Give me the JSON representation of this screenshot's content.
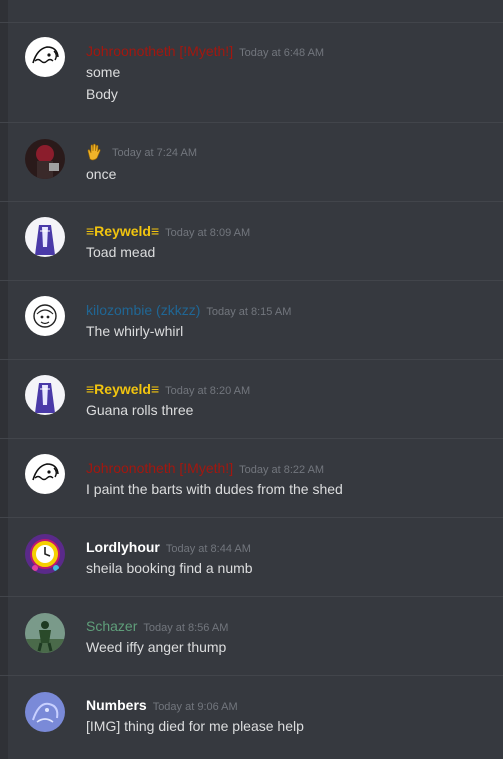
{
  "colors": {
    "background": "#36393f",
    "divider": "#42454b",
    "text": "#dcddde",
    "timestamp": "#72767d",
    "johroonotheth": "#a3170f",
    "reyweld": "#f1c40f",
    "kilozombie": "#206694",
    "lordlyhour": "#ffffff",
    "schazer": "#5f9e7a",
    "numbers": "#ffffff"
  },
  "messages": [
    {
      "author": "Johroonotheth [!Myeth!]",
      "timestamp": "Today at 6:48 AM",
      "lines": [
        "some",
        "Body"
      ],
      "avatar_icon": "sketch-face-avatar"
    },
    {
      "author_icon": "raised-hand-emoji-icon",
      "timestamp": "Today at 7:24 AM",
      "lines": [
        "once"
      ],
      "avatar_icon": "dark-red-figure-avatar"
    },
    {
      "author": "≡Reyweld≡",
      "timestamp": "Today at 8:09 AM",
      "lines": [
        "Toad mead"
      ],
      "avatar_icon": "purple-robe-figure-avatar"
    },
    {
      "author": "kilozombie (zkkzz)",
      "timestamp": "Today at 8:15 AM",
      "lines": [
        "The whirly-whirl"
      ],
      "avatar_icon": "sketch-creature-avatar"
    },
    {
      "author": "≡Reyweld≡",
      "timestamp": "Today at 8:20 AM",
      "lines": [
        "Guana rolls three"
      ],
      "avatar_icon": "purple-robe-figure-avatar"
    },
    {
      "author": "Johroonotheth [!Myeth!]",
      "timestamp": "Today at 8:22 AM",
      "lines": [
        "I paint the barts with dudes from the shed"
      ],
      "avatar_icon": "sketch-face-avatar"
    },
    {
      "author": "Lordlyhour",
      "timestamp": "Today at 8:44 AM",
      "lines": [
        "sheila booking find a numb"
      ],
      "avatar_icon": "clock-avatar"
    },
    {
      "author": "Schazer",
      "timestamp": "Today at 8:56 AM",
      "lines": [
        "Weed iffy anger thump"
      ],
      "avatar_icon": "green-figure-avatar"
    },
    {
      "author": "Numbers",
      "timestamp": "Today at 9:06 AM",
      "lines": [
        "[IMG] thing died for me please help"
      ],
      "avatar_icon": "blue-creature-avatar"
    }
  ]
}
